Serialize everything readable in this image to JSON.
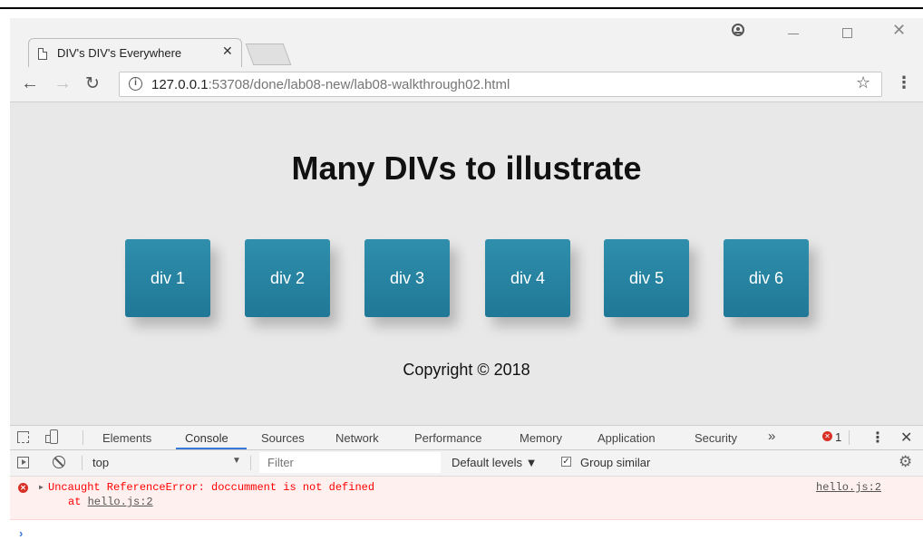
{
  "browser": {
    "tab_title": "DIV's DIV's Everywhere",
    "url_host": "127.0.0.1",
    "url_path": ":53708/done/lab08-new/lab08-walkthrough02.html",
    "icons": {
      "back": "arrow-left-icon",
      "forward": "arrow-right-icon",
      "reload": "reload-icon",
      "info": "info-icon",
      "bookmark": "star-icon",
      "menu": "kebab-menu-icon"
    }
  },
  "page": {
    "heading": "Many DIVs to illustrate",
    "boxes": [
      "div 1",
      "div 2",
      "div 3",
      "div 4",
      "div 5",
      "div 6"
    ],
    "box_color": "#2a87a6",
    "background": "#e8e8e8",
    "copyright": "Copyright © 2018"
  },
  "devtools": {
    "tabs": [
      "Elements",
      "Console",
      "Sources",
      "Network",
      "Performance",
      "Memory",
      "Application",
      "Security"
    ],
    "active_tab": "Console",
    "more_tabs": "»",
    "error_count": "1",
    "context": "top",
    "filter_placeholder": "Filter",
    "levels": "Default levels ▼",
    "group_similar": "Group similar",
    "group_similar_checked": true,
    "console": {
      "error_message": "Uncaught ReferenceError: doccumment is not defined",
      "error_at": "at",
      "error_at_link": "hello.js:2",
      "error_source": "hello.js:2",
      "prompt": "›"
    }
  }
}
